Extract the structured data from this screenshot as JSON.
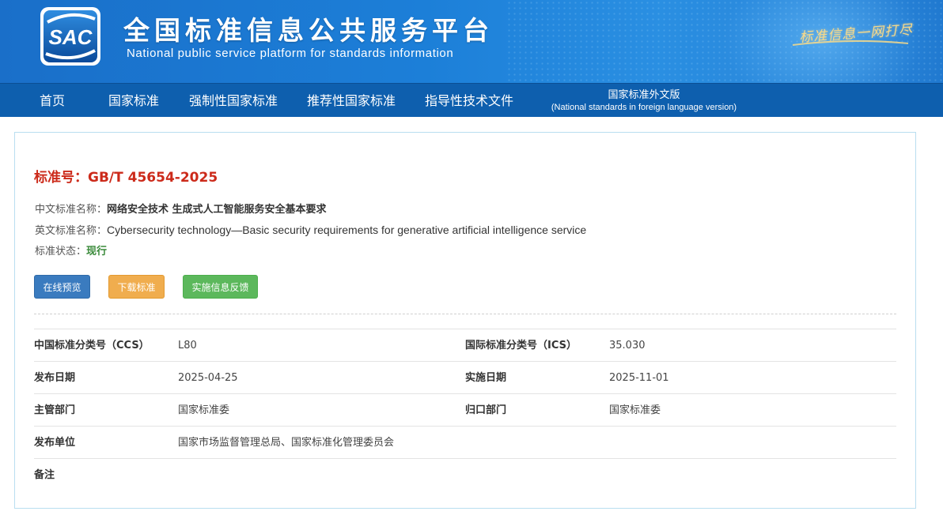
{
  "header": {
    "logo_text": "SAC",
    "title": "全国标准信息公共服务平台",
    "subtitle": "National public service platform  for standards information",
    "slogan": "标准信息一网打尽",
    "colors": {
      "banner": "#1c7fd8",
      "nav": "#0e5fae",
      "slogan": "#f6d98a"
    }
  },
  "nav": {
    "items": [
      {
        "label": "首页"
      },
      {
        "label": "国家标准"
      },
      {
        "label": "强制性国家标准"
      },
      {
        "label": "推荐性国家标准"
      },
      {
        "label": "指导性技术文件"
      }
    ],
    "foreign": {
      "cn": "国家标准外文版",
      "en": "(National standards in foreign language version)"
    }
  },
  "standard": {
    "number_label": "标准号：",
    "number": "GB/T 45654-2025",
    "cn_name_label": "中文标准名称：",
    "cn_name": "网络安全技术 生成式人工智能服务安全基本要求",
    "en_name_label": "英文标准名称：",
    "en_name": "Cybersecurity technology—Basic security requirements for generative artificial intelligence service",
    "status_label": "标准状态：",
    "status": "现行",
    "title_color": "#cc2a1a",
    "status_color": "#3a8a3a"
  },
  "buttons": {
    "preview": "在线预览",
    "download": "下载标准",
    "feedback": "实施信息反馈"
  },
  "info": {
    "ccs_label": "中国标准分类号（CCS）",
    "ccs": "L80",
    "ics_label": "国际标准分类号（ICS）",
    "ics": "35.030",
    "publish_date_label": "发布日期",
    "publish_date": "2025-04-25",
    "impl_date_label": "实施日期",
    "impl_date": "2025-11-01",
    "competent_dept_label": "主管部门",
    "competent_dept": "国家标准委",
    "attributed_dept_label": "归口部门",
    "attributed_dept": "国家标准委",
    "issuer_label": "发布单位",
    "issuer": "国家市场监督管理总局、国家标准化管理委员会",
    "remark_label": "备注",
    "remark": ""
  }
}
